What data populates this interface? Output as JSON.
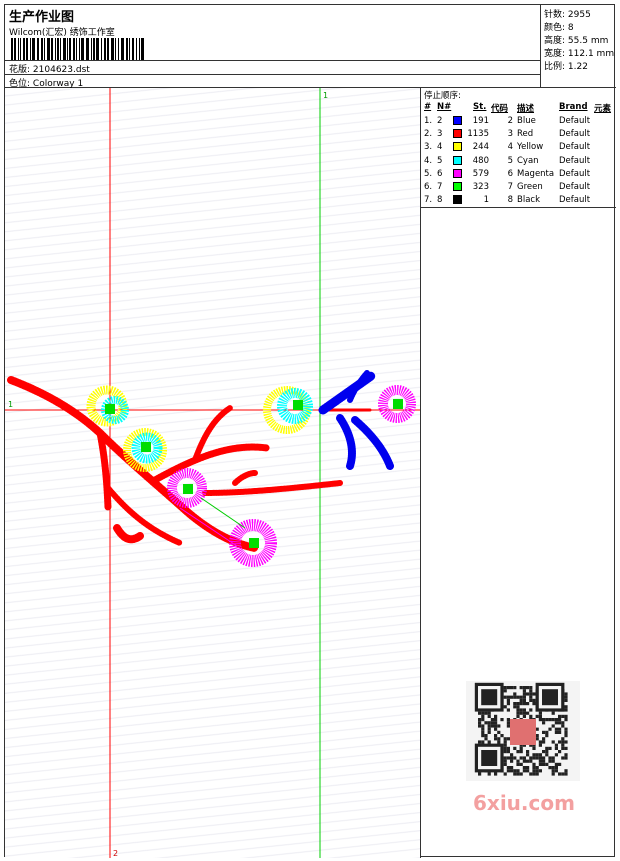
{
  "header": {
    "title": "生产作业图",
    "subtitle": "Wilcom(汇宏) 绣饰工作室",
    "design_label": "花版:",
    "design_value": "2104623.dst",
    "colorway_label": "色位:",
    "colorway_value": "Colorway 1"
  },
  "stats": {
    "stitches_label": "针数:",
    "stitches_value": "2955",
    "colors_label": "颜色:",
    "colors_value": "8",
    "height_label": "高度:",
    "height_value": "55.5 mm",
    "width_label": "宽度:",
    "width_value": "112.1 mm",
    "scale_label": "比例:",
    "scale_value": "1.22"
  },
  "stop_sequence": {
    "title": "停止顺序:",
    "headers": {
      "num": "#",
      "n": "N#",
      "st": "St.",
      "code": "代码",
      "desc": "描述",
      "brand": "Brand",
      "elem": "元素"
    },
    "rows": [
      {
        "num": "1.",
        "n": "2",
        "st": "191",
        "code": "2",
        "desc": "Blue",
        "brand": "Default",
        "color": "#0000ff"
      },
      {
        "num": "2.",
        "n": "3",
        "st": "1135",
        "code": "3",
        "desc": "Red",
        "brand": "Default",
        "color": "#ff0000"
      },
      {
        "num": "3.",
        "n": "4",
        "st": "244",
        "code": "4",
        "desc": "Yellow",
        "brand": "Default",
        "color": "#ffff00"
      },
      {
        "num": "4.",
        "n": "5",
        "st": "480",
        "code": "5",
        "desc": "Cyan",
        "brand": "Default",
        "color": "#00ffff"
      },
      {
        "num": "5.",
        "n": "6",
        "st": "579",
        "code": "6",
        "desc": "Magenta",
        "brand": "Default",
        "color": "#ff00ff"
      },
      {
        "num": "6.",
        "n": "7",
        "st": "323",
        "code": "7",
        "desc": "Green",
        "brand": "Default",
        "color": "#00ff00"
      },
      {
        "num": "7.",
        "n": "8",
        "st": "1",
        "code": "8",
        "desc": "Black",
        "brand": "Default",
        "color": "#000000"
      }
    ]
  },
  "guides": {
    "h_label": "1",
    "v_green_label": "1",
    "v_red_label": "2"
  },
  "watermark": {
    "text": "6xiu.com"
  }
}
